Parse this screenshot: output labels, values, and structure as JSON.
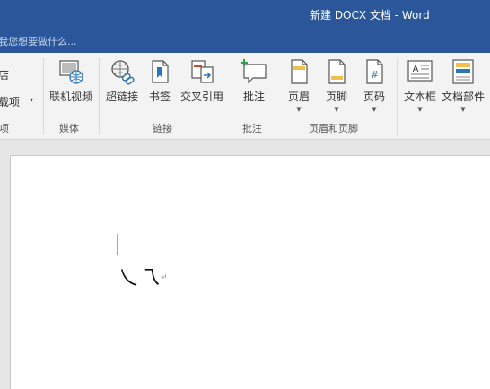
{
  "window": {
    "title": "新建 DOCX 文档 - Word"
  },
  "tell_me": {
    "placeholder": "我您想要做什么..."
  },
  "ribbon": {
    "left_partial": {
      "store_label": "店",
      "addins_label": "载项",
      "group_label": "项"
    },
    "groups": [
      {
        "name": "媒体",
        "buttons": [
          {
            "label": "联机视频",
            "icon": "online-video-icon"
          }
        ]
      },
      {
        "name": "链接",
        "buttons": [
          {
            "label": "超链接",
            "icon": "hyperlink-icon"
          },
          {
            "label": "书签",
            "icon": "bookmark-icon"
          },
          {
            "label": "交叉引用",
            "icon": "cross-reference-icon"
          }
        ]
      },
      {
        "name": "批注",
        "buttons": [
          {
            "label": "批注",
            "icon": "comment-icon"
          }
        ]
      },
      {
        "name": "页眉和页脚",
        "buttons": [
          {
            "label": "页眉",
            "icon": "header-icon"
          },
          {
            "label": "页脚",
            "icon": "footer-icon"
          },
          {
            "label": "页码",
            "icon": "page-number-icon"
          }
        ]
      },
      {
        "name": "",
        "buttons": [
          {
            "label": "文本框",
            "icon": "text-box-icon"
          },
          {
            "label": "文档部件",
            "icon": "quick-parts-icon"
          }
        ]
      }
    ]
  },
  "document": {
    "text": "乀乁",
    "pilcrow": "↵"
  },
  "colors": {
    "title_bar": "#2b579a",
    "ribbon": "#f3f3f3",
    "workspace": "#e6e6e6",
    "page": "#ffffff"
  }
}
